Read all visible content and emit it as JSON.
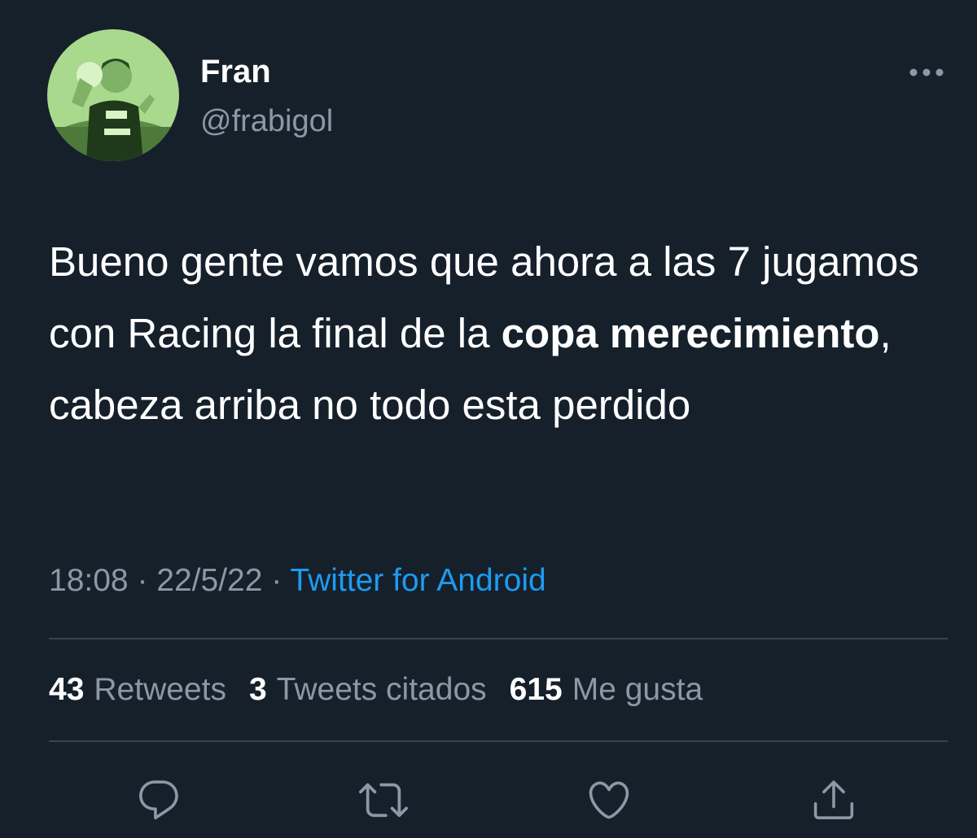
{
  "user": {
    "display_name": "Fran",
    "handle": "@frabigol",
    "avatar": "avatar-photo"
  },
  "tweet": {
    "text_before": "Bueno gente vamos que ahora a las 7 jugamos con Racing la final de la ",
    "text_bold": "copa merecimiento",
    "text_after": ", cabeza arriba no todo esta perdido"
  },
  "meta": {
    "time": "18:08",
    "separator": "·",
    "date": "22/5/22",
    "source": "Twitter for Android"
  },
  "stats": {
    "retweets_count": "43",
    "retweets_label": "Retweets",
    "quotes_count": "3",
    "quotes_label": "Tweets citados",
    "likes_count": "615",
    "likes_label": "Me gusta"
  },
  "icons": {
    "more": "more-icon",
    "reply": "reply-icon",
    "retweet": "retweet-icon",
    "like": "heart-icon",
    "share": "share-icon"
  },
  "colors": {
    "background": "#15202b",
    "text_primary": "#ffffff",
    "text_secondary": "#8b98a5",
    "link": "#1d9bf0",
    "divider": "#38444d",
    "avatar_tint": "#b7e59a"
  }
}
